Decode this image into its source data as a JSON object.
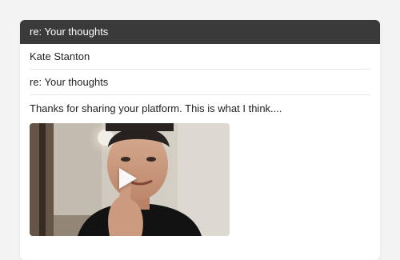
{
  "email": {
    "window_title": "re: Your thoughts",
    "from": "Kate Stanton",
    "subject": "re: Your thoughts",
    "body": "Thanks for sharing your platform. This is what I think....",
    "video": {
      "play_icon": "play-icon",
      "thumbnail": "video-thumbnail"
    }
  },
  "colors": {
    "titlebar_bg": "#3a3a3a",
    "card_bg": "#ffffff",
    "page_bg": "#f3f3f3"
  }
}
